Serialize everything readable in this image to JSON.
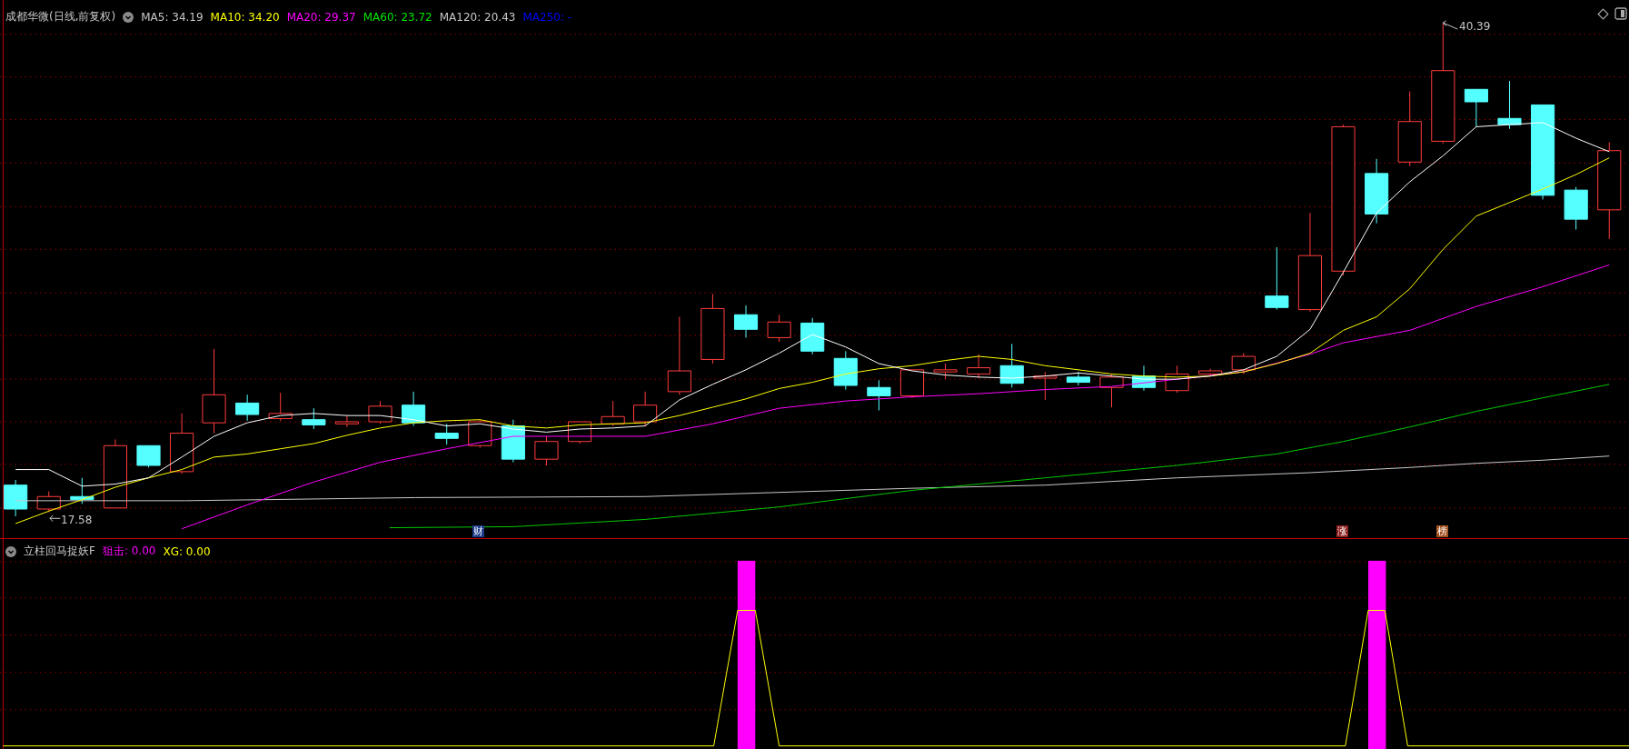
{
  "main_chart": {
    "title": "成都华微(日线,前复权)",
    "indicators": [
      {
        "label": "MA5: 34.19",
        "color": "#c8c8c8"
      },
      {
        "label": "MA10: 34.20",
        "color": "#ffff00"
      },
      {
        "label": "MA20: 29.37",
        "color": "#ff00ff"
      },
      {
        "label": "MA60: 23.72",
        "color": "#00e600"
      },
      {
        "label": "MA120: 20.43",
        "color": "#c8c8c8"
      },
      {
        "label": "MA250: -",
        "color": "#0000ff"
      }
    ],
    "high_label": "40.39",
    "low_label": "17.58",
    "event_markers": [
      {
        "label": "财",
        "color": "#1e3c8c"
      },
      {
        "label": "涨",
        "color": "#8c1e1e"
      },
      {
        "label": "榜",
        "color": "#a0501e"
      }
    ]
  },
  "indicator_chart": {
    "title": "立柱回马捉妖F",
    "values": [
      {
        "label": "狙击: 0.00",
        "color": "#ff00ff"
      },
      {
        "label": "XG: 0.00",
        "color": "#ffff00"
      }
    ]
  }
}
